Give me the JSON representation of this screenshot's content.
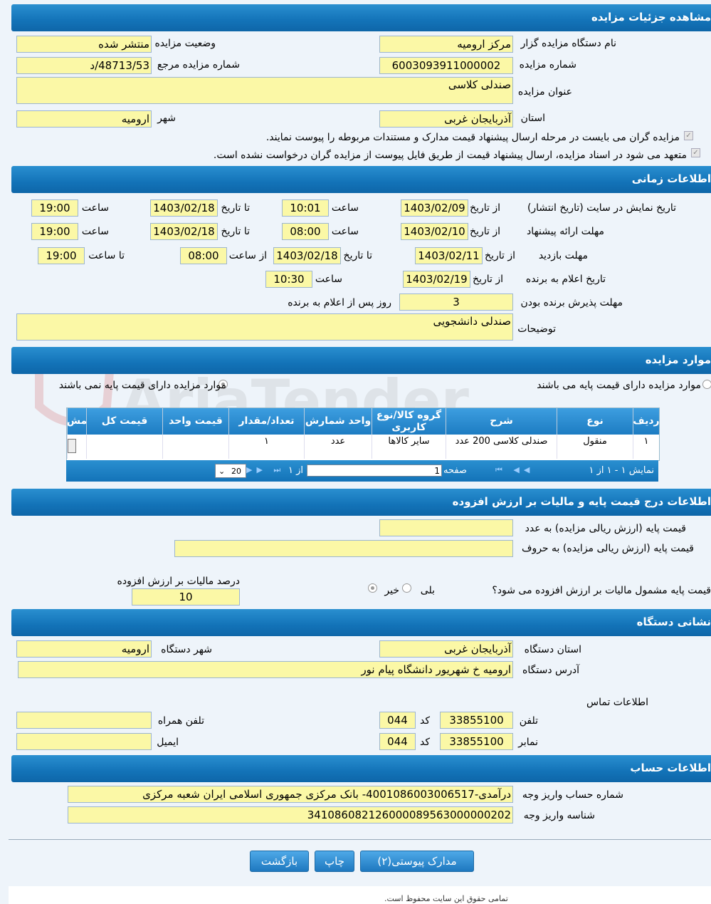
{
  "sections": {
    "details": "مشاهده جزئیات مزایده",
    "timing": "اطلاعات زمانی",
    "items": "موارد مزایده",
    "pricing": "اطلاعات درج قیمت پایه و مالیات بر ارزش افزوده",
    "address": "نشانی دستگاه",
    "account": "اطلاعات حساب"
  },
  "details": {
    "organizer_label": "نام دستگاه مزایده گزار",
    "organizer": "مرکز ارومیه",
    "status_label": "وضعیت مزایده",
    "status": "منتشر شده",
    "number_label": "شماره مزایده",
    "number": "6003093911000002",
    "ref_label": "شماره مزایده مرجع",
    "ref": "48713/53/د",
    "title_label": "عنوان مزایده",
    "title": "صندلی کلاسی",
    "province_label": "استان",
    "province": "آذربایجان غربی",
    "city_label": "شهر",
    "city": "ارومیه",
    "check1": "مزایده گران می بایست در مرحله ارسال پیشنهاد قیمت مدارک و مستندات مربوطه را پیوست نمایند.",
    "check2": "متعهد می شود در اسناد مزایده، ارسال پیشنهاد قیمت از طریق فایل پیوست از مزایده گران درخواست نشده است."
  },
  "timing": {
    "from_date": "از تاریخ",
    "to_date": "تا تاریخ",
    "time": "ساعت",
    "from_time": "از ساعت",
    "to_time": "تا ساعت",
    "publish_label": "تاریخ نمایش در سایت (تاریخ انتشار)",
    "publish_from": "1403/02/09",
    "publish_from_time": "10:01",
    "publish_to": "1403/02/18",
    "publish_to_time": "19:00",
    "offer_label": "مهلت ارائه پیشنهاد",
    "offer_from": "1403/02/10",
    "offer_from_time": "08:00",
    "offer_to": "1403/02/18",
    "offer_to_time": "19:00",
    "visit_label": "مهلت بازدید",
    "visit_from": "1403/02/11",
    "visit_to": "1403/02/18",
    "visit_from_time": "08:00",
    "visit_to_time": "19:00",
    "winner_label": "تاریخ اعلام به برنده",
    "winner_from": "1403/02/19",
    "winner_time": "10:30",
    "accept_label": "مهلت پذیرش برنده بودن",
    "accept_days": "3",
    "accept_suffix": "روز پس از اعلام به برنده",
    "desc_label": "توضیحات",
    "desc": "صندلی دانشجویی"
  },
  "items": {
    "radio_with": "موارد مزایده دارای قیمت پایه می باشند",
    "radio_without": "موارد مزایده دارای قیمت پایه نمی باشند",
    "headers": [
      "ردیف",
      "نوع",
      "شرح",
      "گروه کالا/نوع کاربری",
      "واحد شمارش",
      "تعداد/مقدار",
      "قیمت واحد",
      "قیمت کل",
      "مش"
    ],
    "row": [
      "۱",
      "منقول",
      "صندلی کلاسی 200 عدد",
      "سایر کالاها",
      "عدد",
      "۱",
      "",
      "",
      ""
    ],
    "pager_info": "نمایش ۱ - ۱ از ۱",
    "page_label": "صفحه",
    "page": "1",
    "of_label": "از ۱",
    "page_size": "20"
  },
  "pricing": {
    "base_num_label": "قیمت پایه (ارزش ریالی مزایده) به عدد",
    "base_num": "",
    "base_words_label": "قیمت پایه (ارزش ریالی مزایده) به حروف",
    "base_words": "",
    "vat_question": "قیمت پایه مشمول مالیات بر ارزش افزوده می شود؟",
    "yes": "بلی",
    "no": "خیر",
    "vat_pct_label": "درصد مالیات بر ارزش افزوده",
    "vat_pct": "10"
  },
  "address": {
    "province_label": "استان دستگاه",
    "province": "آذربایجان غربی",
    "city_label": "شهر دستگاه",
    "city": "ارومیه",
    "addr_label": "آدرس دستگاه",
    "addr": "ارومیه خ شهریور دانشگاه پیام نور",
    "contact_label": "اطلاعات تماس",
    "phone_label": "تلفن",
    "phone": "33855100",
    "code_label": "کد",
    "phone_code": "044",
    "mobile_label": "تلفن همراه",
    "mobile": "",
    "fax_label": "نمابر",
    "fax": "33855100",
    "fax_code": "044",
    "email_label": "ایمیل",
    "email": ""
  },
  "account": {
    "acct_label": "شماره حساب واریز وجه",
    "acct": "درآمدی-4001086003006517- بانک مرکزی جمهوری اسلامی ایران شعبه مرکزی",
    "id_label": "شناسه واریز وجه",
    "id": "341086082126000089563000000202"
  },
  "buttons": {
    "docs": "مدارک پیوستی(۲)",
    "print": "چاپ",
    "back": "بازگشت"
  },
  "watermark": "AriaTender.neT",
  "footer": "تمامی حقوق این سایت محفوظ است."
}
